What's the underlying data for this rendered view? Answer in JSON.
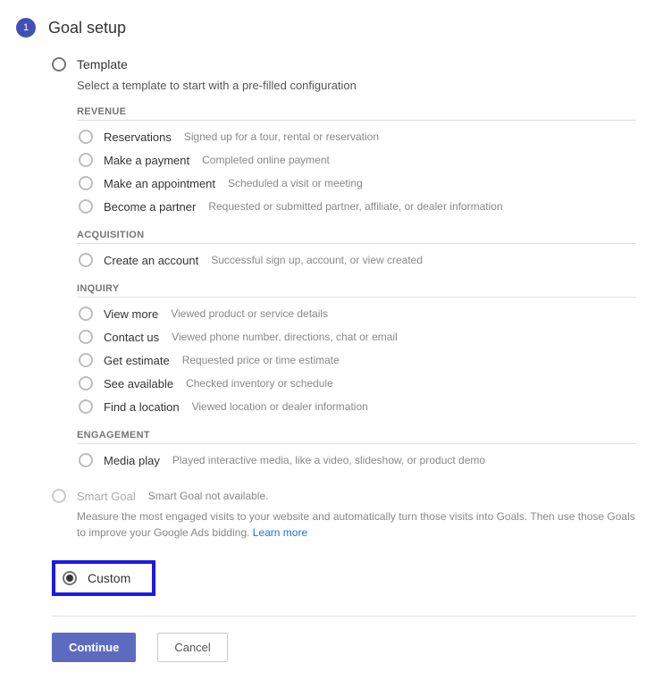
{
  "step": {
    "number": "1",
    "title": "Goal setup"
  },
  "templateOption": {
    "label": "Template",
    "helper": "Select a template to start with a pre-filled configuration"
  },
  "categories": [
    {
      "name": "REVENUE",
      "items": [
        {
          "name": "Reservations",
          "desc": "Signed up for a tour, rental or reservation"
        },
        {
          "name": "Make a payment",
          "desc": "Completed online payment"
        },
        {
          "name": "Make an appointment",
          "desc": "Scheduled a visit or meeting"
        },
        {
          "name": "Become a partner",
          "desc": "Requested or submitted partner, affiliate, or dealer information"
        }
      ]
    },
    {
      "name": "ACQUISITION",
      "items": [
        {
          "name": "Create an account",
          "desc": "Successful sign up, account, or view created"
        }
      ]
    },
    {
      "name": "INQUIRY",
      "items": [
        {
          "name": "View more",
          "desc": "Viewed product or service details"
        },
        {
          "name": "Contact us",
          "desc": "Viewed phone number, directions, chat or email"
        },
        {
          "name": "Get estimate",
          "desc": "Requested price or time estimate"
        },
        {
          "name": "See available",
          "desc": "Checked inventory or schedule"
        },
        {
          "name": "Find a location",
          "desc": "Viewed location or dealer information"
        }
      ]
    },
    {
      "name": "ENGAGEMENT",
      "items": [
        {
          "name": "Media play",
          "desc": "Played interactive media, like a video, slideshow, or product demo"
        }
      ]
    }
  ],
  "smartGoal": {
    "label": "Smart Goal",
    "status": "Smart Goal not available.",
    "desc": "Measure the most engaged visits to your website and automatically turn those visits into Goals. Then use those Goals to improve your Google Ads bidding. ",
    "learnMore": "Learn more"
  },
  "customOption": {
    "label": "Custom"
  },
  "buttons": {
    "continue": "Continue",
    "cancel": "Cancel"
  }
}
